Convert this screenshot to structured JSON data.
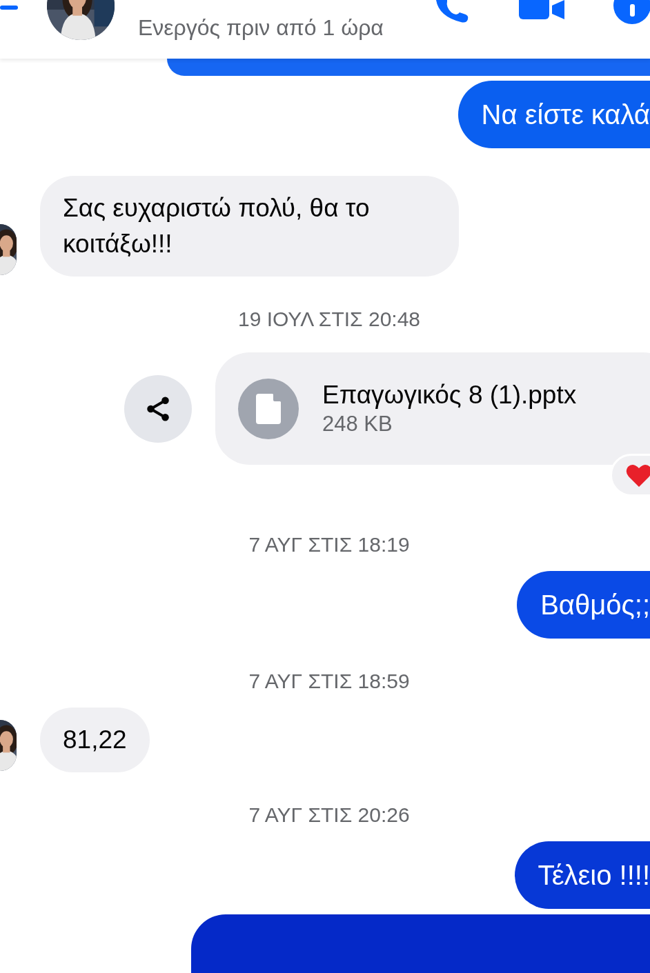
{
  "header": {
    "status": "Ενεργός πριν από 1 ώρα"
  },
  "messages": [
    {
      "kind": "sent_partial"
    },
    {
      "kind": "sent",
      "text": "Να είστε καλά"
    },
    {
      "kind": "received",
      "text": "Σας ευχαριστώ πολύ, θα το κοιτάξω!!!"
    },
    {
      "kind": "timestamp",
      "text": "19 ΙΟΥΛ ΣΤΙΣ 20:48"
    },
    {
      "kind": "file",
      "name": "Επαγωγικός 8 (1).pptx",
      "size": "248 KB",
      "reacted": true
    },
    {
      "kind": "timestamp",
      "text": "7 ΑΥΓ ΣΤΙΣ 18:19"
    },
    {
      "kind": "sent",
      "text": "Βαθμός;;"
    },
    {
      "kind": "timestamp",
      "text": "7 ΑΥΓ ΣΤΙΣ 18:59"
    },
    {
      "kind": "received",
      "text": "81,22"
    },
    {
      "kind": "timestamp",
      "text": "7 ΑΥΓ ΣΤΙΣ 20:26"
    },
    {
      "kind": "sent",
      "text": "Τέλειο !!!!"
    },
    {
      "kind": "sent_partial"
    }
  ]
}
